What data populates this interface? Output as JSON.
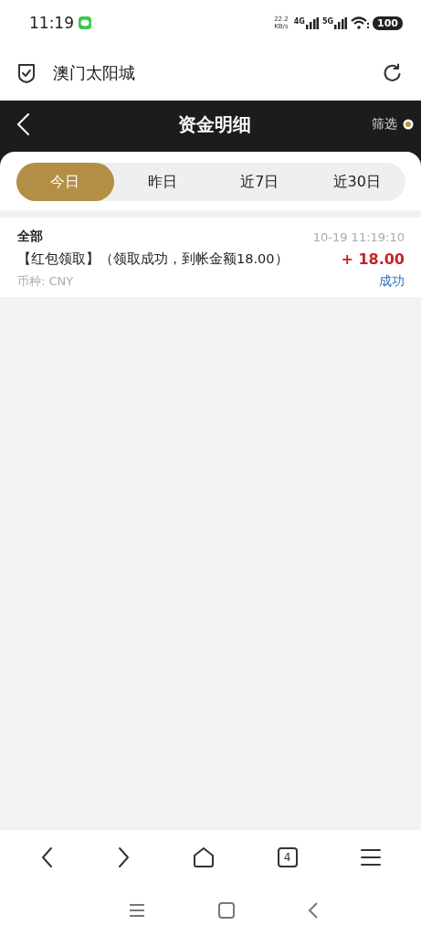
{
  "status_bar": {
    "time": "11:19",
    "net_speed": "22.2",
    "net_unit": "KB/s",
    "sim_1": "4G",
    "sim_2": "5G",
    "battery": "100"
  },
  "browser": {
    "site_title": "澳门太阳城"
  },
  "header": {
    "title": "资金明细",
    "filter": "筛选"
  },
  "tabs": [
    {
      "label": "今日",
      "selected": true
    },
    {
      "label": "昨日",
      "selected": false
    },
    {
      "label": "近7日",
      "selected": false
    },
    {
      "label": "近30日",
      "selected": false
    }
  ],
  "records": [
    {
      "category": "全部",
      "time": "10-19 11:19:10",
      "description": "【红包领取】（领取成功，到帐金额18.00）",
      "amount": "+ 18.00",
      "currency": "币种: CNY",
      "status": "成功"
    }
  ],
  "browser_nav": {
    "tab_count": "4"
  }
}
